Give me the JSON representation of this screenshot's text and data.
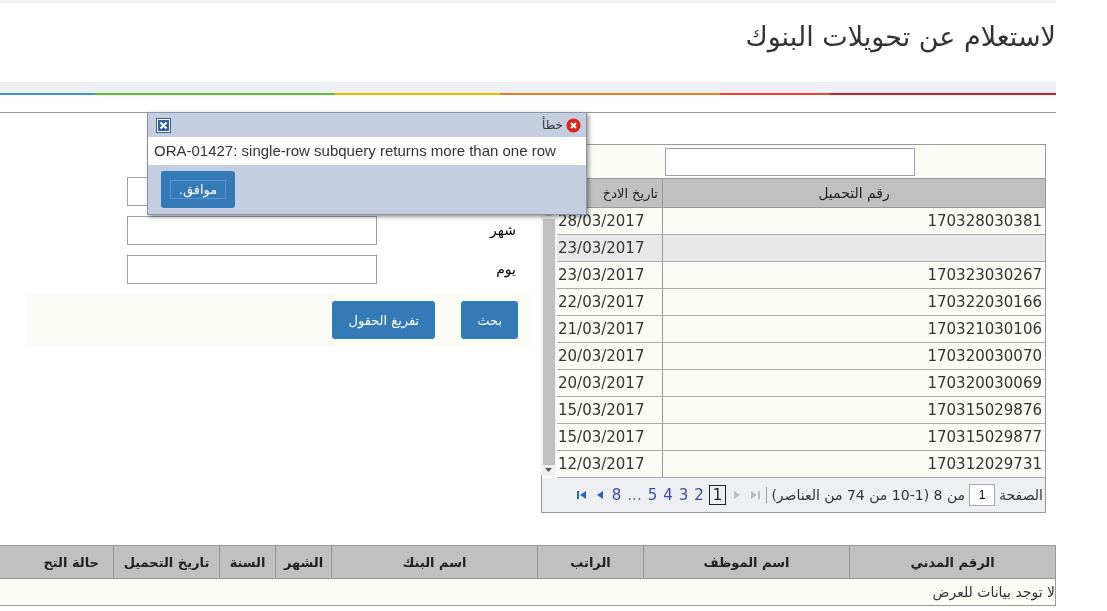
{
  "page_title": "لاستعلام عن تحويلات البنوك",
  "error_dialog": {
    "title": "خطأ",
    "message": "ORA-01427: single-row subquery returns more than one row",
    "button": "موافق."
  },
  "filter_form": {
    "fields": [
      {
        "kind": "text"
      },
      {
        "kind": "text",
        "label": "شهر"
      },
      {
        "kind": "text",
        "label": "يوم"
      }
    ],
    "buttons": [
      "بحث",
      "تفريغ الحقول"
    ]
  },
  "uploads_grid": {
    "columns": [
      "رقم التحميل",
      "تاريخ الادخ"
    ],
    "rows": [
      {
        "date": "28/03/2017",
        "number": "170328030381",
        "selected": false
      },
      {
        "date": "23/03/2017",
        "selected": true
      },
      {
        "date": "23/03/2017",
        "number": "170323030267",
        "selected": false
      },
      {
        "date": "22/03/2017",
        "number": "170322030166",
        "selected": false
      },
      {
        "date": "21/03/2017",
        "number": "170321030106",
        "selected": false
      },
      {
        "date": "20/03/2017",
        "number": "170320030070",
        "selected": false
      },
      {
        "date": "20/03/2017",
        "number": "170320030069",
        "selected": false
      },
      {
        "date": "15/03/2017",
        "number": "170315029876",
        "selected": false
      },
      {
        "date": "15/03/2017",
        "number": "170315029877",
        "selected": false
      },
      {
        "date": "12/03/2017",
        "number": "170312029731",
        "selected": false
      }
    ],
    "pager": {
      "label": "الصفحة",
      "page_input": "1",
      "summary": "من 8 (1-10 من 74 من العناصر)",
      "pages": [
        {
          "label": "1",
          "selected": true
        },
        {
          "label": "2",
          "selected": false
        },
        {
          "label": "3",
          "selected": false
        },
        {
          "label": "4",
          "selected": false
        },
        {
          "label": "5",
          "selected": false
        },
        {
          "label": "...",
          "kind": "ellipsis"
        },
        {
          "label": "8",
          "selected": false
        }
      ]
    }
  },
  "salaries_table": {
    "columns": [
      "الرقم المدني",
      "اسم الموظف",
      "الراتب",
      "اسم البنك",
      "الشهر",
      "السنة",
      "تاريخ التحميل",
      "حالة التح"
    ],
    "empty_message": "لا توجد بيانات للعرض"
  }
}
